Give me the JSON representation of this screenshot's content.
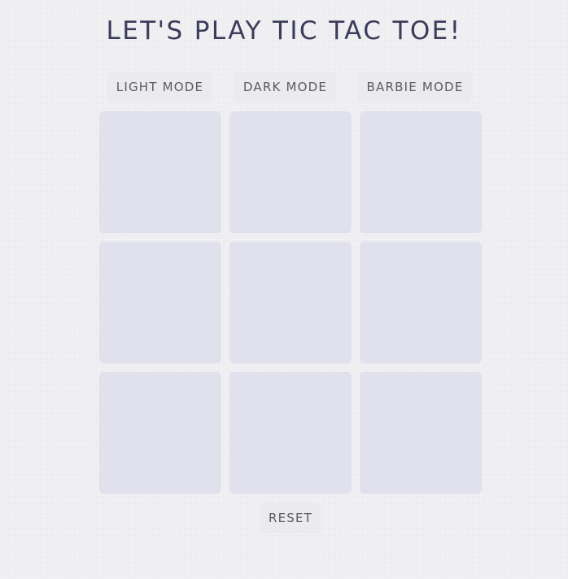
{
  "title": "LET'S PLAY TIC TAC TOE!",
  "modes": {
    "light_label": "LIGHT MODE",
    "dark_label": "DARK MODE",
    "barbie_label": "BARBIE MODE"
  },
  "board": {
    "cells": [
      "",
      "",
      "",
      "",
      "",
      "",
      "",
      "",
      ""
    ]
  },
  "reset_label": "RESET",
  "colors": {
    "background": "#f1f1f3",
    "cell": "#e1e1ee",
    "button": "#ebebed",
    "title_text": "#3b3b5c",
    "button_text": "#5a5a64"
  }
}
